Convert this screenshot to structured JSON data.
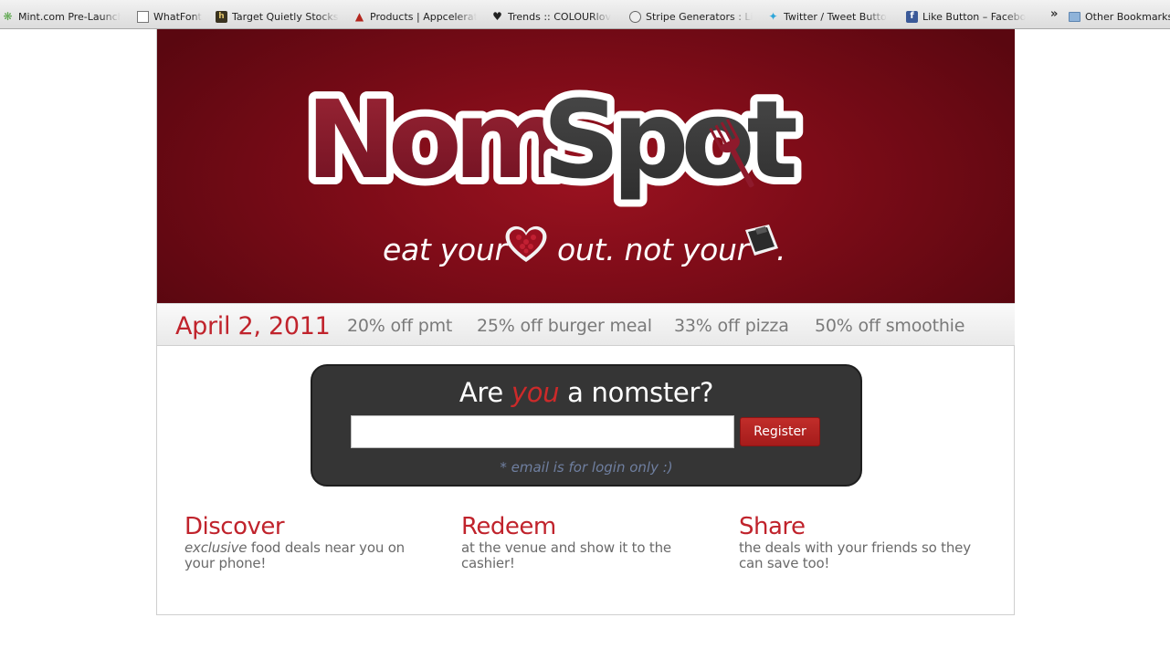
{
  "bookmarks": [
    {
      "label": "Mint.com Pre-Launch",
      "icon": "mint-icon"
    },
    {
      "label": "WhatFont",
      "icon": "page-icon"
    },
    {
      "label": "Target Quietly Stocks",
      "icon": "target-news-icon"
    },
    {
      "label": "Products | Appcelerat",
      "icon": "appcelerator-icon"
    },
    {
      "label": "Trends :: COLOURlov",
      "icon": "colourlovers-heart-icon"
    },
    {
      "label": "Stripe Generators : Li",
      "icon": "stripe-generator-icon"
    },
    {
      "label": "Twitter / Tweet Butto",
      "icon": "twitter-bird-icon"
    },
    {
      "label": "Like Button – Facebo",
      "icon": "facebook-icon"
    },
    {
      "label": "Other Bookmarks",
      "icon": "folder-icon"
    }
  ],
  "bookmarks_overflow": "»",
  "hero": {
    "logo_text_part1": "Nom",
    "logo_text_part2": "Spot",
    "tagline_1": "eat your",
    "tagline_2": "out. not your",
    "tagline_3": "."
  },
  "deals": {
    "date": "April 2, 2011",
    "items": [
      "20% off pmt",
      "25% off burger meal",
      "33% off pizza",
      "50% off smoothie"
    ]
  },
  "signup": {
    "question_pre": "Are",
    "question_you": "you",
    "question_post": "a nomster?",
    "email_value": "",
    "register_label": "Register",
    "note": "* email is for login only :)"
  },
  "features": [
    {
      "title": "Discover",
      "text_em": "exclusive",
      "text": " food deals near you on your phone!"
    },
    {
      "title": "Redeem",
      "text_em": "",
      "text": "at the venue and show it to the cashier!"
    },
    {
      "title": "Share",
      "text_em": "",
      "text": "the deals with your friends so they can save too!"
    }
  ],
  "colors": {
    "brand_red": "#c0232c",
    "hero_dark_red": "#7e0c18",
    "signup_bg": "#353535",
    "register_bg": "#b02422"
  }
}
